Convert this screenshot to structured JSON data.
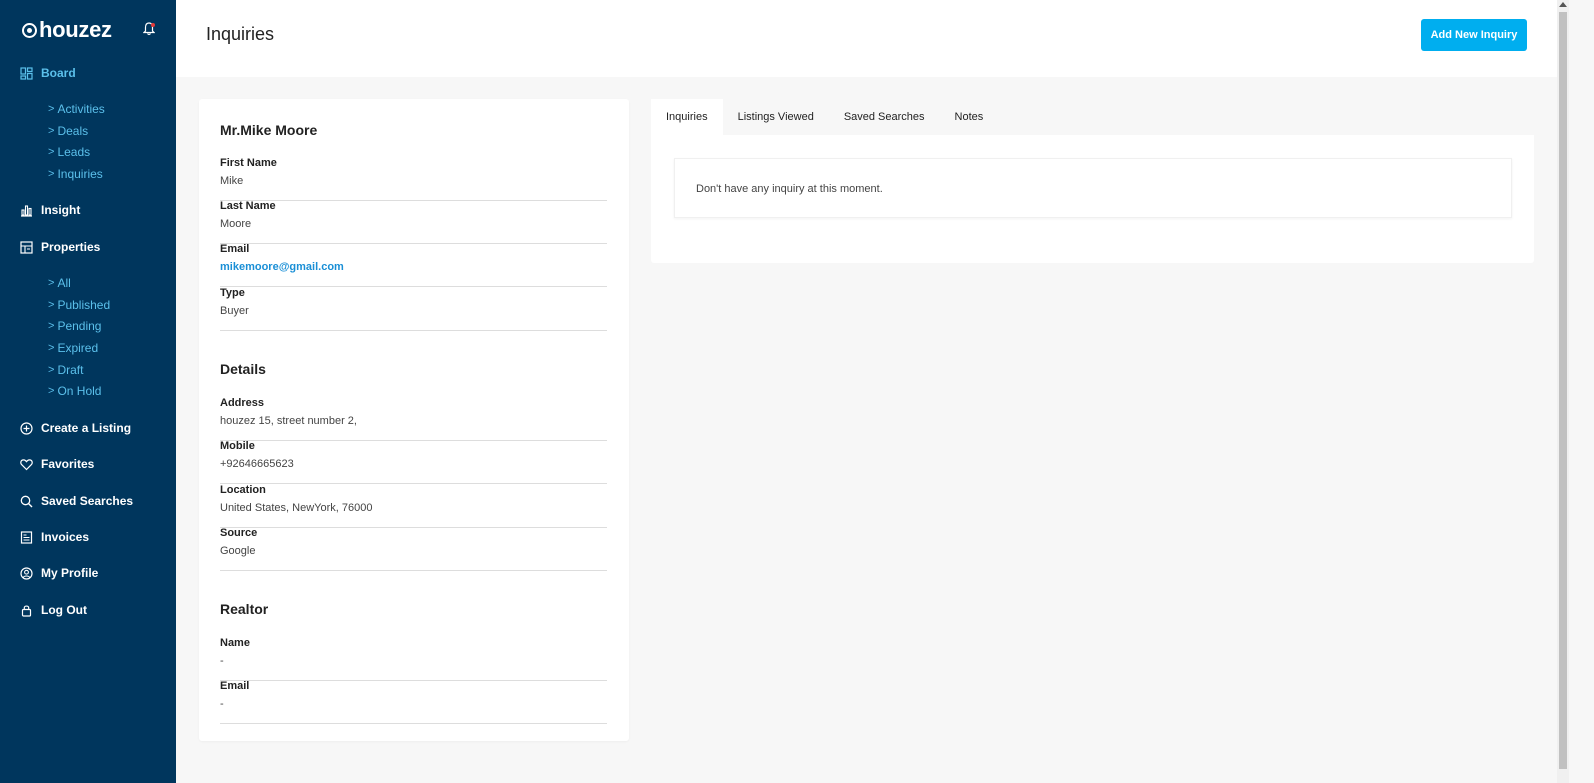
{
  "app": {
    "brand": "houzez"
  },
  "sidebar": {
    "items": [
      {
        "label": "Board",
        "icon": "dashboard-icon",
        "active": true
      },
      {
        "label": "Activities",
        "sub": true
      },
      {
        "label": "Deals",
        "sub": true
      },
      {
        "label": "Leads",
        "sub": true
      },
      {
        "label": "Inquiries",
        "sub": true
      },
      {
        "label": "Insight",
        "icon": "bar-chart-icon"
      },
      {
        "label": "Properties",
        "icon": "properties-icon"
      },
      {
        "label": "All",
        "sub": true
      },
      {
        "label": "Published",
        "sub": true
      },
      {
        "label": "Pending",
        "sub": true
      },
      {
        "label": "Expired",
        "sub": true
      },
      {
        "label": "Draft",
        "sub": true
      },
      {
        "label": "On Hold",
        "sub": true
      },
      {
        "label": "Create a Listing",
        "icon": "plus-circle-icon"
      },
      {
        "label": "Favorites",
        "icon": "heart-icon"
      },
      {
        "label": "Saved Searches",
        "icon": "search-icon"
      },
      {
        "label": "Invoices",
        "icon": "invoice-icon"
      },
      {
        "label": "My Profile",
        "icon": "user-circle-icon"
      },
      {
        "label": "Log Out",
        "icon": "lock-icon"
      }
    ],
    "chevron": ">"
  },
  "header": {
    "title": "Inquiries",
    "add_button": "Add New Inquiry"
  },
  "contact": {
    "name": "Mr.Mike Moore",
    "fields": [
      {
        "label": "First Name",
        "value": "Mike"
      },
      {
        "label": "Last Name",
        "value": "Moore"
      },
      {
        "label": "Email",
        "value": "mikemoore@gmail.com"
      },
      {
        "label": "Type",
        "value": "Buyer"
      }
    ]
  },
  "details": {
    "title": "Details",
    "fields": [
      {
        "label": "Address",
        "value": "houzez 15, street number 2,"
      },
      {
        "label": "Mobile",
        "value": "+92646665623"
      },
      {
        "label": "Location",
        "value": "United States, NewYork, 76000"
      },
      {
        "label": "Source",
        "value": "Google"
      }
    ]
  },
  "realtor": {
    "title": "Realtor",
    "fields": [
      {
        "label": "Name",
        "value": "-"
      },
      {
        "label": "Email",
        "value": "-"
      }
    ]
  },
  "tabs": {
    "items": [
      "Inquiries",
      "Listings Viewed",
      "Saved Searches",
      "Notes"
    ],
    "active": "Inquiries",
    "empty_message": "Don't have any inquiry at this moment."
  },
  "colors": {
    "sidebar_bg": "#00365d",
    "accent": "#00aeef",
    "link": "#5bc0eb"
  }
}
